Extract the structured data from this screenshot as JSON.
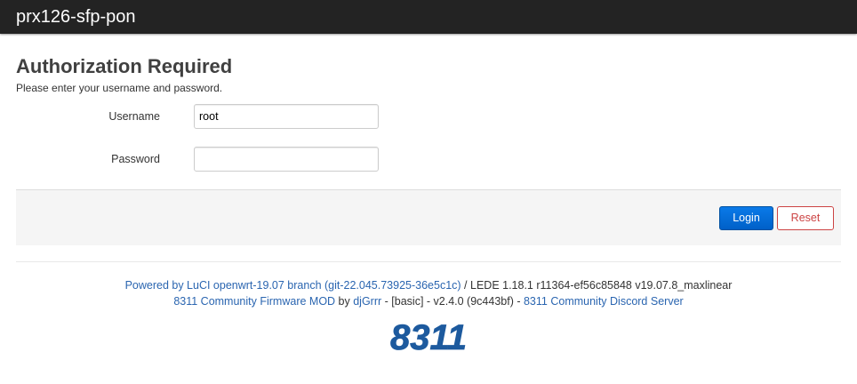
{
  "header": {
    "brand": "prx126-sfp-pon"
  },
  "main": {
    "title": "Authorization Required",
    "subtitle": "Please enter your username and password."
  },
  "form": {
    "username_label": "Username",
    "username_value": "root",
    "password_label": "Password",
    "password_value": ""
  },
  "actions": {
    "login_label": "Login",
    "reset_label": "Reset"
  },
  "footer": {
    "powered_link": "Powered by LuCI openwrt-19.07 branch (git-22.045.73925-36e5c1c)",
    "version_text": " / LEDE 1.18.1 r11364-ef56c85848 v19.07.8_maxlinear",
    "firmware_link": "8311 Community Firmware MOD",
    "by_text": " by ",
    "author_link": "djGrrr",
    "build_text": " - [basic] - v2.4.0 (9c443bf) - ",
    "discord_link": "8311 Community Discord Server",
    "logo_text": "8311"
  },
  "colors": {
    "topbar": "#232323",
    "link": "#2a65b0",
    "login": "#0069d6",
    "reset": "#cc4444",
    "logo": "#1d5a9e"
  }
}
